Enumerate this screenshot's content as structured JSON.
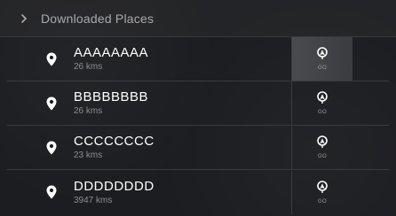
{
  "header": {
    "title": "Downloaded Places",
    "icon": "chevron-right-icon"
  },
  "places": [
    {
      "name": "AAAAAAAA",
      "distance": "26 kms",
      "go_label": "GO",
      "active": true
    },
    {
      "name": "BBBBBBBB",
      "distance": "26 kms",
      "go_label": "GO",
      "active": false
    },
    {
      "name": "CCCCCCCC",
      "distance": "23 kms",
      "go_label": "GO",
      "active": false
    },
    {
      "name": "DDDDDDDD",
      "distance": "3947 kms",
      "go_label": "GO",
      "active": false
    }
  ],
  "colors": {
    "background": "#1c1d20",
    "text_primary": "#ffffff",
    "text_secondary": "#8d8e91",
    "header_text": "#a9aaad",
    "divider": "#3a3b3e"
  }
}
